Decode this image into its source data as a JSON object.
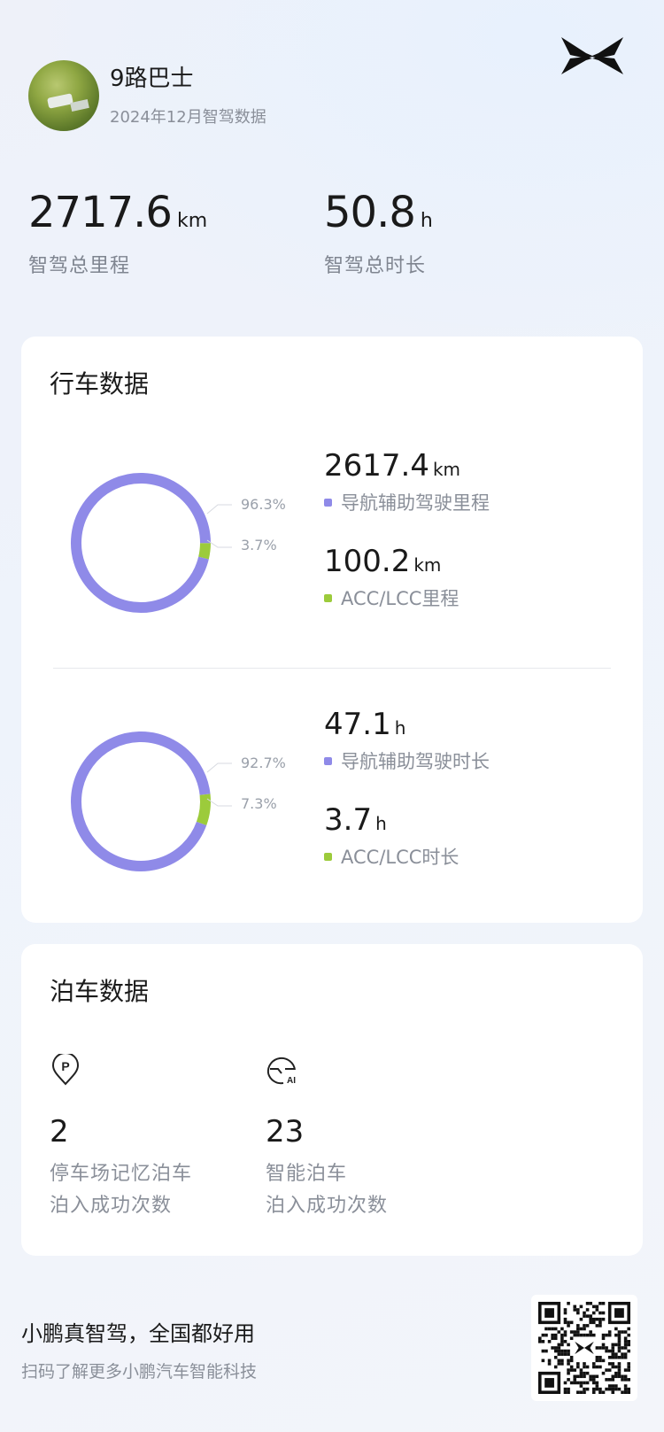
{
  "header": {
    "user_name": "9路巴士",
    "subtitle": "2024年12月智驾数据"
  },
  "summary": {
    "total_distance": {
      "value": "2717.6",
      "unit": "km",
      "label": "智驾总里程"
    },
    "total_duration": {
      "value": "50.8",
      "unit": "h",
      "label": "智驾总时长"
    }
  },
  "driving": {
    "title": "行车数据",
    "distance": {
      "nav": {
        "value": "2617.4",
        "unit": "km",
        "label": "导航辅助驾驶里程",
        "percent_label": "96.3%"
      },
      "acc": {
        "value": "100.2",
        "unit": "km",
        "label": "ACC/LCC里程",
        "percent_label": "3.7%"
      }
    },
    "duration": {
      "nav": {
        "value": "47.1",
        "unit": "h",
        "label": "导航辅助驾驶时长",
        "percent_label": "92.7%"
      },
      "acc": {
        "value": "3.7",
        "unit": "h",
        "label": "ACC/LCC时长",
        "percent_label": "7.3%"
      }
    }
  },
  "chart_data": [
    {
      "type": "pie",
      "categories": [
        "导航辅助驾驶里程",
        "ACC/LCC里程"
      ],
      "values": [
        96.3,
        3.7
      ],
      "title": "",
      "colors": [
        "#8f8ae8",
        "#9ccb3b"
      ]
    },
    {
      "type": "pie",
      "categories": [
        "导航辅助驾驶时长",
        "ACC/LCC时长"
      ],
      "values": [
        92.7,
        7.3
      ],
      "title": "",
      "colors": [
        "#8f8ae8",
        "#9ccb3b"
      ]
    }
  ],
  "parking": {
    "title": "泊车数据",
    "items": [
      {
        "icon": "parking-pin-icon",
        "value": "2",
        "label_line1": "停车场记忆泊车",
        "label_line2": "泊入成功次数"
      },
      {
        "icon": "ai-steering-icon",
        "value": "23",
        "label_line1": "智能泊车",
        "label_line2": "泊入成功次数"
      }
    ]
  },
  "footer": {
    "slogan": "小鹏真智驾，全国都好用",
    "sub": "扫码了解更多小鹏汽车智能科技"
  },
  "colors": {
    "nav_purple": "#8f8ae8",
    "acc_green": "#9ccb3b"
  }
}
